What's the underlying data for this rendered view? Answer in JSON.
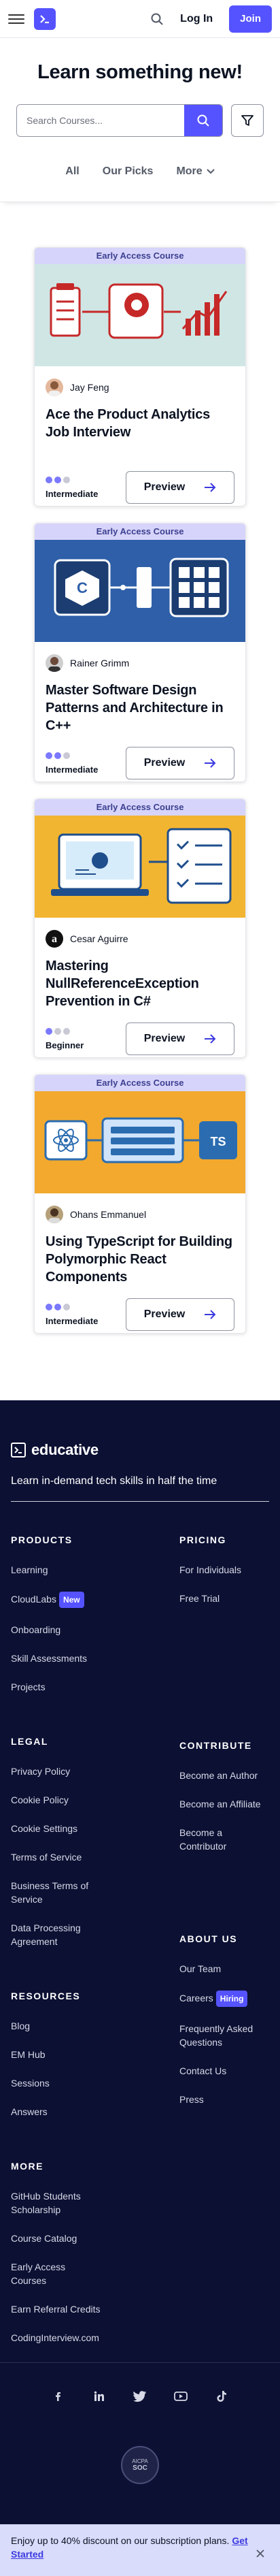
{
  "nav": {
    "login": "Log In",
    "join": "Join"
  },
  "hero": {
    "title": "Learn something new!",
    "search_placeholder": "Search Courses...",
    "tabs": [
      "All",
      "Our Picks",
      "More"
    ]
  },
  "cards": [
    {
      "ribbon": "Early Access Course",
      "author": "Jay Feng",
      "title": "Ace the Product Analytics Job Interview",
      "level": "Intermediate",
      "level_value": 2,
      "preview": "Preview"
    },
    {
      "ribbon": "Early Access Course",
      "author": "Rainer Grimm",
      "title": "Master Software Design Patterns and Architecture in C++",
      "level": "Intermediate",
      "level_value": 2,
      "preview": "Preview"
    },
    {
      "ribbon": "Early Access Course",
      "author": "Cesar Aguirre",
      "title": "Mastering NullReferenceException Prevention in C#",
      "level": "Beginner",
      "level_value": 1,
      "preview": "Preview"
    },
    {
      "ribbon": "Early Access Course",
      "author": "Ohans Emmanuel",
      "title": "Using TypeScript for Building Polymorphic React Components",
      "level": "Intermediate",
      "level_value": 2,
      "preview": "Preview"
    }
  ],
  "footer": {
    "brand": "educative",
    "tagline": "Learn in-demand tech skills in half the time",
    "products": {
      "heading": "PRODUCTS",
      "items": [
        "Learning",
        "CloudLabs",
        "Onboarding",
        "Skill Assessments",
        "Projects"
      ],
      "cloudlabs_badge": "New"
    },
    "pricing": {
      "heading": "PRICING",
      "items": [
        "For Individuals",
        "Free Trial"
      ]
    },
    "legal": {
      "heading": "LEGAL",
      "items": [
        "Privacy Policy",
        "Cookie Policy",
        "Cookie Settings",
        "Terms of Service",
        "Business Terms of Service",
        "Data Processing Agreement"
      ]
    },
    "contribute": {
      "heading": "CONTRIBUTE",
      "items": [
        "Become an Author",
        "Become an Affiliate",
        "Become a Contributor"
      ]
    },
    "resources": {
      "heading": "RESOURCES",
      "items": [
        "Blog",
        "EM Hub",
        "Sessions",
        "Answers"
      ]
    },
    "about": {
      "heading": "ABOUT US",
      "items": [
        "Our Team",
        "Careers",
        "Frequently Asked Questions",
        "Contact Us",
        "Press"
      ],
      "careers_badge": "Hiring"
    },
    "more": {
      "heading": "MORE",
      "items": [
        "GitHub Students Scholarship",
        "Course Catalog",
        "Early Access Courses",
        "Earn Referral Credits",
        "CodingInterview.com"
      ]
    },
    "seal": {
      "line1": "AICPA",
      "line2": "SOC"
    }
  },
  "promo": {
    "text": "Enjoy up to 40% discount on our subscription plans.",
    "link": "Get Started"
  },
  "colors": {
    "brand": "#5553ff",
    "footer_bg": "#0c1033",
    "ribbon": "#d7d4fb"
  }
}
